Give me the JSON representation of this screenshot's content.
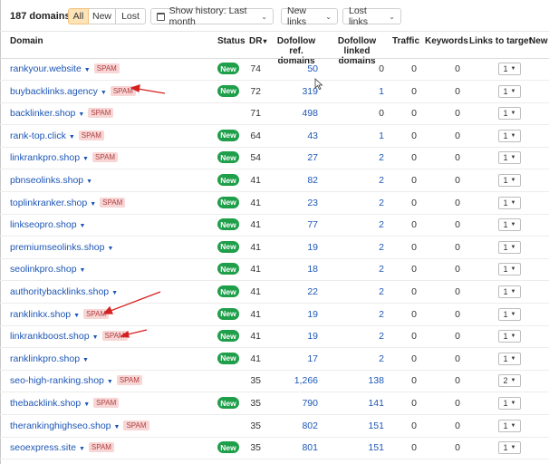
{
  "toolbar": {
    "count_label": "187 domains",
    "filter_all": "All",
    "filter_new": "New",
    "filter_lost": "Lost",
    "history_label": "Show history: Last month",
    "new_links_label": "New links",
    "lost_links_label": "Lost links",
    "active_filter": "All",
    "active_color": "#fde3b8"
  },
  "table": {
    "headers": {
      "domain": "Domain",
      "status": "Status",
      "dr": "DR",
      "dofollow_ref_1": "Dofollow ref.",
      "dofollow_ref_2": "domains",
      "dofollow_linked_1": "Dofollow linked",
      "dofollow_linked_2": "domains",
      "traffic": "Traffic",
      "keywords": "Keywords",
      "links_to_target": "Links to target",
      "new_links": "New l"
    },
    "sort_indicator": "▾",
    "spam_label": "SPAM",
    "new_label": "New",
    "rows": [
      {
        "domain": "rankyour.website",
        "spam": true,
        "status": "New",
        "dr": "74",
        "ref": "50",
        "linked": "0",
        "traffic": "0",
        "keywords": "0",
        "links": "1"
      },
      {
        "domain": "buybacklinks.agency",
        "spam": true,
        "status": "New",
        "dr": "72",
        "ref": "319",
        "linked": "1",
        "traffic": "0",
        "keywords": "0",
        "links": "1"
      },
      {
        "domain": "backlinker.shop",
        "spam": true,
        "status": "",
        "dr": "71",
        "ref": "498",
        "linked": "0",
        "traffic": "0",
        "keywords": "0",
        "links": "1"
      },
      {
        "domain": "rank-top.click",
        "spam": true,
        "status": "New",
        "dr": "64",
        "ref": "43",
        "linked": "1",
        "traffic": "0",
        "keywords": "0",
        "links": "1"
      },
      {
        "domain": "linkrankpro.shop",
        "spam": true,
        "status": "New",
        "dr": "54",
        "ref": "27",
        "linked": "2",
        "traffic": "0",
        "keywords": "0",
        "links": "1"
      },
      {
        "domain": "pbnseolinks.shop",
        "spam": false,
        "status": "New",
        "dr": "41",
        "ref": "82",
        "linked": "2",
        "traffic": "0",
        "keywords": "0",
        "links": "1"
      },
      {
        "domain": "toplinkranker.shop",
        "spam": true,
        "status": "New",
        "dr": "41",
        "ref": "23",
        "linked": "2",
        "traffic": "0",
        "keywords": "0",
        "links": "1"
      },
      {
        "domain": "linkseopro.shop",
        "spam": false,
        "status": "New",
        "dr": "41",
        "ref": "77",
        "linked": "2",
        "traffic": "0",
        "keywords": "0",
        "links": "1"
      },
      {
        "domain": "premiumseolinks.shop",
        "spam": false,
        "status": "New",
        "dr": "41",
        "ref": "19",
        "linked": "2",
        "traffic": "0",
        "keywords": "0",
        "links": "1"
      },
      {
        "domain": "seolinkpro.shop",
        "spam": false,
        "status": "New",
        "dr": "41",
        "ref": "18",
        "linked": "2",
        "traffic": "0",
        "keywords": "0",
        "links": "1"
      },
      {
        "domain": "authoritybacklinks.shop",
        "spam": false,
        "status": "New",
        "dr": "41",
        "ref": "22",
        "linked": "2",
        "traffic": "0",
        "keywords": "0",
        "links": "1"
      },
      {
        "domain": "ranklinkx.shop",
        "spam": true,
        "status": "New",
        "dr": "41",
        "ref": "19",
        "linked": "2",
        "traffic": "0",
        "keywords": "0",
        "links": "1"
      },
      {
        "domain": "linkrankboost.shop",
        "spam": true,
        "status": "New",
        "dr": "41",
        "ref": "19",
        "linked": "2",
        "traffic": "0",
        "keywords": "0",
        "links": "1"
      },
      {
        "domain": "ranklinkpro.shop",
        "spam": false,
        "status": "New",
        "dr": "41",
        "ref": "17",
        "linked": "2",
        "traffic": "0",
        "keywords": "0",
        "links": "1"
      },
      {
        "domain": "seo-high-ranking.shop",
        "spam": true,
        "status": "",
        "dr": "35",
        "ref": "1,266",
        "linked": "138",
        "traffic": "0",
        "keywords": "0",
        "links": "2"
      },
      {
        "domain": "thebacklink.shop",
        "spam": true,
        "status": "New",
        "dr": "35",
        "ref": "790",
        "linked": "141",
        "traffic": "0",
        "keywords": "0",
        "links": "1"
      },
      {
        "domain": "therankinghighseo.shop",
        "spam": true,
        "status": "",
        "dr": "35",
        "ref": "802",
        "linked": "151",
        "traffic": "0",
        "keywords": "0",
        "links": "1"
      },
      {
        "domain": "seoexpress.site",
        "spam": true,
        "status": "New",
        "dr": "35",
        "ref": "801",
        "linked": "151",
        "traffic": "0",
        "keywords": "0",
        "links": "1"
      }
    ]
  },
  "colors": {
    "link": "#1d56b5",
    "new_badge": "#1f9f4a",
    "spam_bg": "#f8d6d6",
    "spam_text": "#b04040",
    "annotation_arrow": "#d62020"
  }
}
